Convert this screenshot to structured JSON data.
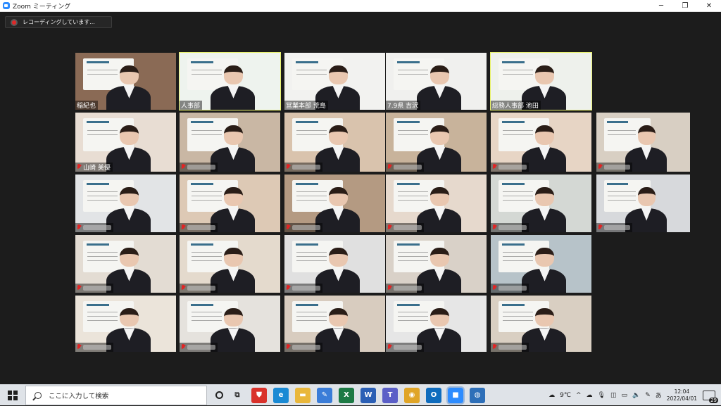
{
  "window": {
    "title": "Zoom ミーティング",
    "controls": [
      "─",
      "❐",
      "✕"
    ]
  },
  "recording": {
    "label": "レコーディングしています..."
  },
  "colors": {
    "spotlight": "#e8f26a",
    "mic_muted": "#e02525",
    "background": "#1c1c1c"
  },
  "participants": [
    {
      "name": "稲紀也",
      "muted": false,
      "wall": "#8a6a55"
    },
    {
      "name": "人事部",
      "muted": false,
      "wall": "#eef3ee",
      "spotlight": true
    },
    {
      "name": "営業本部 荒島",
      "muted": false,
      "wall": "#f2f2f0"
    },
    {
      "name": "7.9県 吉沢",
      "muted": false,
      "wall": "#f0f0ee"
    },
    {
      "name": "総務人事部 池田",
      "muted": false,
      "wall": "#eef1ec",
      "spotlight": true
    },
    {
      "name": "山崎 美優",
      "muted": true,
      "wall": "#e8ddd3"
    },
    {
      "name": "",
      "muted": true,
      "wall": "#c9b7a4"
    },
    {
      "name": "",
      "muted": true,
      "wall": "#d9c3ad"
    },
    {
      "name": "",
      "muted": true,
      "wall": "#c8b39b"
    },
    {
      "name": "",
      "muted": true,
      "wall": "#e7d5c5"
    },
    {
      "name": "",
      "muted": true,
      "wall": "#d8cfc3"
    },
    {
      "name": "",
      "muted": true,
      "wall": "#e2e4e6"
    },
    {
      "name": "",
      "muted": true,
      "wall": "#ddc9b5"
    },
    {
      "name": "",
      "muted": true,
      "wall": "#b49a82"
    },
    {
      "name": "",
      "muted": true,
      "wall": "#e6d9cd"
    },
    {
      "name": "",
      "muted": true,
      "wall": "#d4d8d4"
    },
    {
      "name": "",
      "muted": true,
      "wall": "#d7d9dc"
    },
    {
      "name": "",
      "muted": true,
      "wall": "#e3dcd3"
    },
    {
      "name": "",
      "muted": true,
      "wall": "#e4dacd"
    },
    {
      "name": "",
      "muted": true,
      "wall": "#e0e0e0"
    },
    {
      "name": "",
      "muted": true,
      "wall": "#d9d1c8"
    },
    {
      "name": "",
      "muted": true,
      "wall": "#b7c3c9"
    },
    {
      "name": "",
      "muted": true,
      "wall": "#ebe4da"
    },
    {
      "name": "",
      "muted": true,
      "wall": "#e5e2dd"
    },
    {
      "name": "",
      "muted": true,
      "wall": "#d8ccbf"
    },
    {
      "name": "",
      "muted": true,
      "wall": "#e6e6e6"
    },
    {
      "name": "",
      "muted": true,
      "wall": "#d9cfc2"
    },
    {
      "name": "",
      "muted": true,
      "wall": "#e2e2e2"
    }
  ],
  "taskbar": {
    "search_placeholder": "ここに入力して検索",
    "apps": [
      {
        "icon": "cortana-icon"
      },
      {
        "icon": "task-view-icon",
        "color": "#333333",
        "glyph": "⧉"
      },
      {
        "icon": "security-app-icon",
        "color": "#d9322b",
        "glyph": "⛊"
      },
      {
        "icon": "edge-icon",
        "color": "#1a8ad4",
        "glyph": "e"
      },
      {
        "icon": "file-explorer-icon",
        "color": "#e9b73b",
        "glyph": "▬"
      },
      {
        "icon": "mail-icon",
        "color": "#3b7dd8",
        "glyph": "✎"
      },
      {
        "icon": "excel-icon",
        "color": "#1d7a45",
        "glyph": "X"
      },
      {
        "icon": "word-icon",
        "color": "#2b5fb5",
        "glyph": "W"
      },
      {
        "icon": "teams-icon",
        "color": "#5b5fc7",
        "glyph": "T"
      },
      {
        "icon": "chrome-icon",
        "color": "#e0a527",
        "glyph": "◉"
      },
      {
        "icon": "outlook-icon",
        "color": "#0f6cbd",
        "glyph": "O"
      },
      {
        "icon": "zoom-icon",
        "color": "#2d8cff",
        "glyph": "■"
      },
      {
        "icon": "web-app-icon",
        "color": "#2e6fb8",
        "glyph": "◍"
      }
    ],
    "tray": {
      "weather": "9℃",
      "up_arrow": "^",
      "ime": "あ",
      "time": "12:04",
      "date": "2022/04/01",
      "notifications": "29"
    }
  }
}
